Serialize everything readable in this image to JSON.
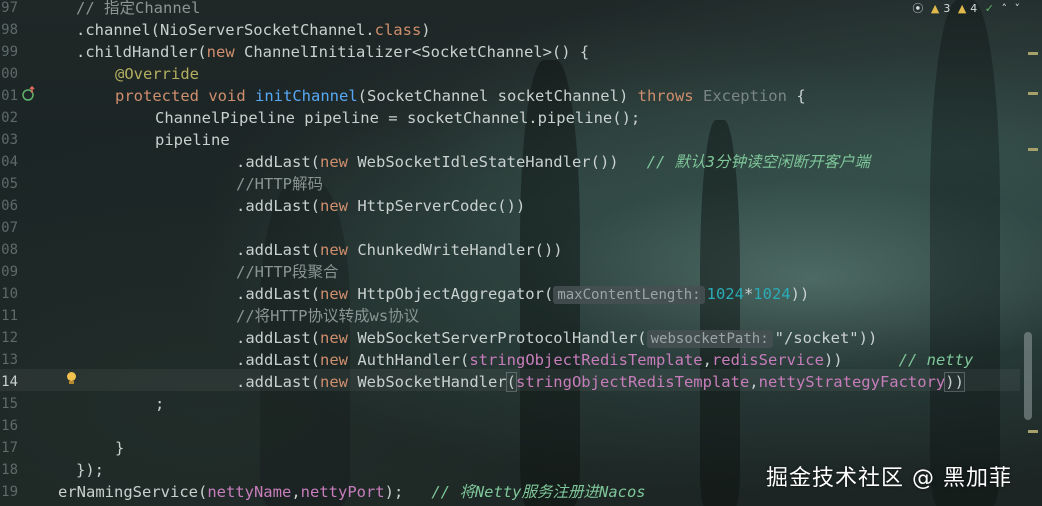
{
  "editor": {
    "line_numbers": [
      "97",
      "98",
      "99",
      "00",
      "01",
      "02",
      "03",
      "04",
      "05",
      "06",
      "07",
      "08",
      "09",
      "10",
      "11",
      "12",
      "13",
      "14",
      "15",
      "16",
      "17",
      "18",
      "19"
    ],
    "inspections": {
      "warnings": "3",
      "weak_warnings": "4"
    },
    "tokens": {
      "l97_comment": "// 指定Channel",
      "l98_a": ".channel(NioServerSocketChannel.",
      "l98_class": "class",
      "l98_b": ")",
      "l99_a": ".childHandler(",
      "l99_new": "new",
      "l99_b": " ChannelInitializer<SocketChannel>() {",
      "l00_ann": "@Override",
      "l01_protected": "protected",
      "l01_void": "void",
      "l01_fn": "initChannel",
      "l01_params": "(SocketChannel socketChannel) ",
      "l01_throws": "throws",
      "l01_exception": "Exception",
      "l01_brace": " {",
      "l02": "ChannelPipeline pipeline = socketChannel.pipeline();",
      "l03": "pipeline",
      "l04_a": ".addLast(",
      "l04_new": "new",
      "l04_b": " WebSocketIdleStateHandler())",
      "l04_comment": "// 默认3分钟读空闲断开客户端",
      "l05_comment": "//HTTP解码",
      "l06_a": ".addLast(",
      "l06_new": "new",
      "l06_b": " HttpServerCodec())",
      "l08_a": ".addLast(",
      "l08_new": "new",
      "l08_b": " ChunkedWriteHandler())",
      "l09_comment": "//HTTP段聚合",
      "l10_a": ".addLast(",
      "l10_new": "new",
      "l10_b": " HttpObjectAggregator(",
      "l10_hint": "maxContentLength:",
      "l10_num1": "1024",
      "l10_op": "*",
      "l10_num2": "1024",
      "l10_c": "))",
      "l11_comment": "//将HTTP协议转成ws协议",
      "l12_a": ".addLast(",
      "l12_new": "new",
      "l12_b": " WebSocketServerProtocolHandler(",
      "l12_hint": "websocketPath:",
      "l12_str": "\"/socket\"",
      "l12_c": "))",
      "l13_a": ".addLast(",
      "l13_new": "new",
      "l13_b": " AuthHandler(",
      "l13_f1": "stringObjectRedisTemplate",
      "l13_comma": ",",
      "l13_f2": "redisService",
      "l13_c": "))",
      "l13_comment": "// netty",
      "l14_a": ".addLast(",
      "l14_new": "new",
      "l14_b": " WebSocketHandler",
      "l14_paren": "(",
      "l14_f1": "stringObjectRedisTemplate",
      "l14_comma": ",",
      "l14_f2": "nettyStrategyFactory",
      "l14_c": "))",
      "l15": ";",
      "l17": "}",
      "l18": "});",
      "l19_a": "erNamingService(",
      "l19_f1": "nettyName",
      "l19_comma": ",",
      "l19_f2": "nettyPort",
      "l19_b": ");",
      "l19_comment": "// 将Netty服务注册进Nacos"
    }
  },
  "watermark": "掘金技术社区 @ 黑加菲",
  "colors": {
    "keyword": "#cf8e6d",
    "annotation": "#b3ae60",
    "function": "#56a8f5",
    "comment": "#7ec699",
    "string": "#6aab73",
    "number": "#2aacb8",
    "field": "#c77dbb"
  },
  "icons": [
    "override-gutter-icon",
    "intention-bulb-icon",
    "warning-icon",
    "inspection-check-icon"
  ]
}
